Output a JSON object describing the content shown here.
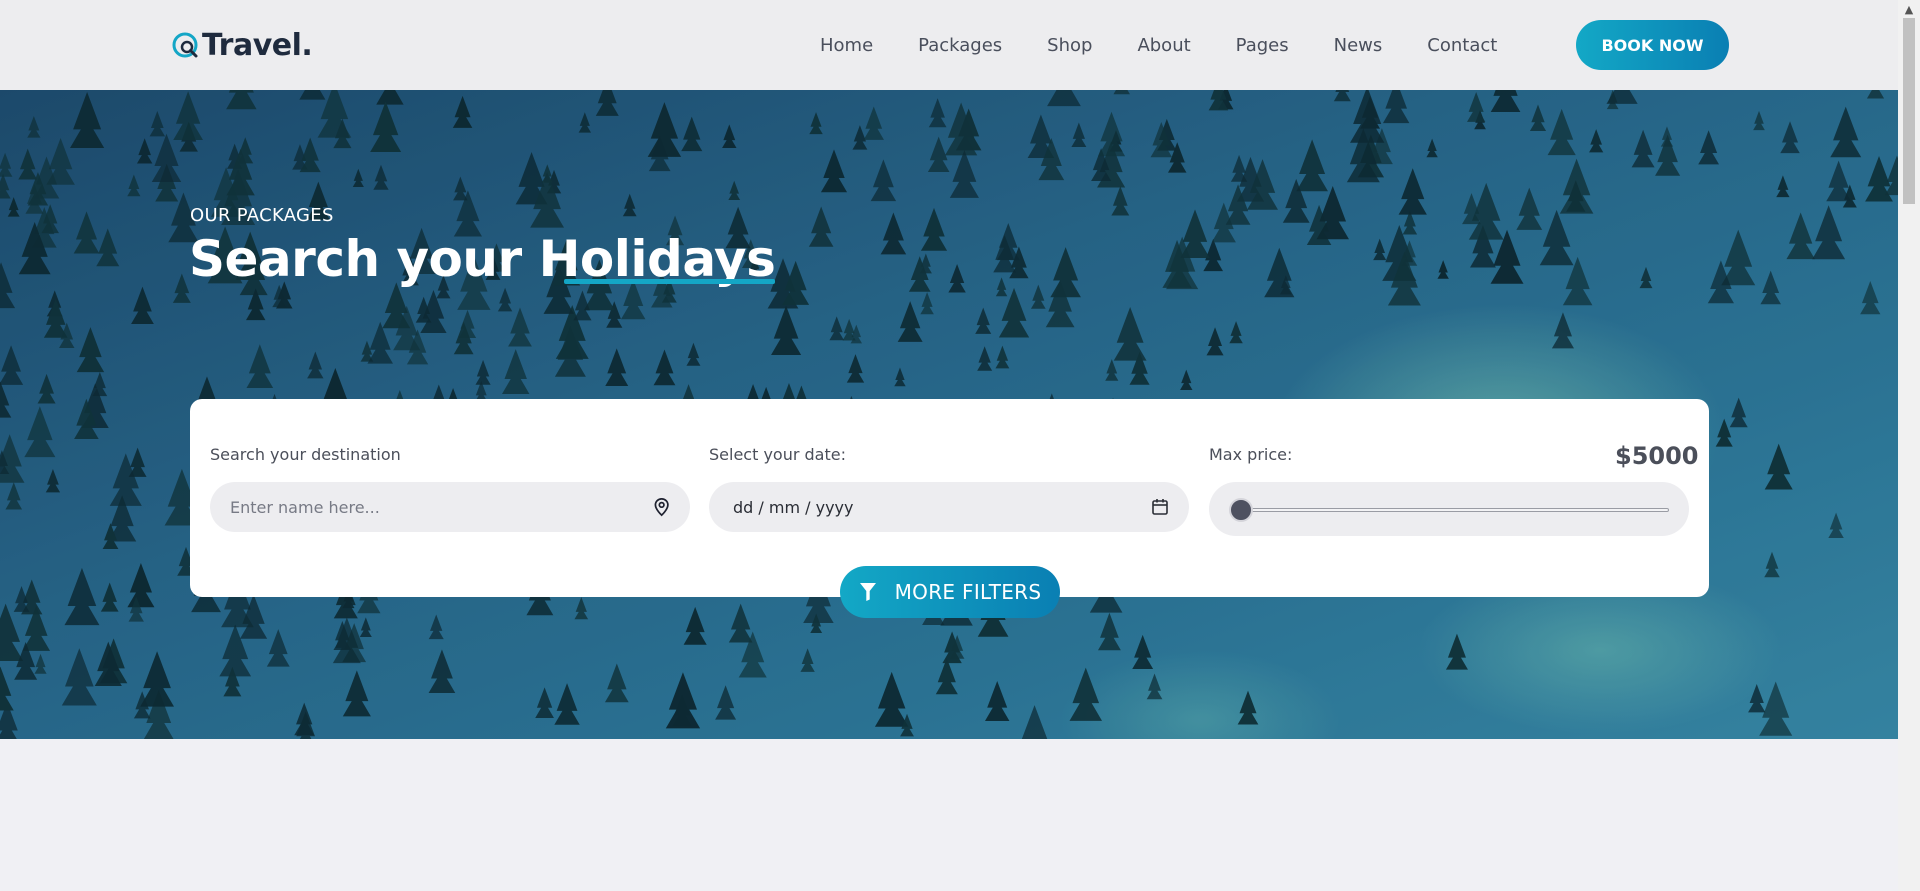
{
  "header": {
    "logo_text": "Travel.",
    "nav": [
      {
        "label": "Home"
      },
      {
        "label": "Packages"
      },
      {
        "label": "Shop"
      },
      {
        "label": "About"
      },
      {
        "label": "Pages"
      },
      {
        "label": "News"
      },
      {
        "label": "Contact"
      }
    ],
    "book_label": "BOOK NOW"
  },
  "hero": {
    "eyebrow": "OUR PACKAGES",
    "title_start": "Search your ",
    "title_highlight": "Holidays"
  },
  "search": {
    "destination_label": "Search your destination",
    "destination_placeholder": "Enter name here...",
    "date_label": "Select your date:",
    "date_value": "dd / mm / yyyy",
    "price_label": "Max price:",
    "price_value": "$5000",
    "price_slider_fraction": 0,
    "filters_label": "MORE FILTERS"
  },
  "icons": {
    "destination": "location-pin-icon",
    "date": "calendar-icon",
    "filter": "funnel-icon",
    "social": [
      "facebook-icon",
      "instagram-icon",
      "tripadvisor-icon"
    ],
    "view": [
      "list-view-icon",
      "grid-view-icon"
    ]
  },
  "colors": {
    "accent": "#13a8c6",
    "accent_dark": "#0a7fb3",
    "header_bg": "#ededef",
    "page_bg": "#f0f0f4"
  }
}
